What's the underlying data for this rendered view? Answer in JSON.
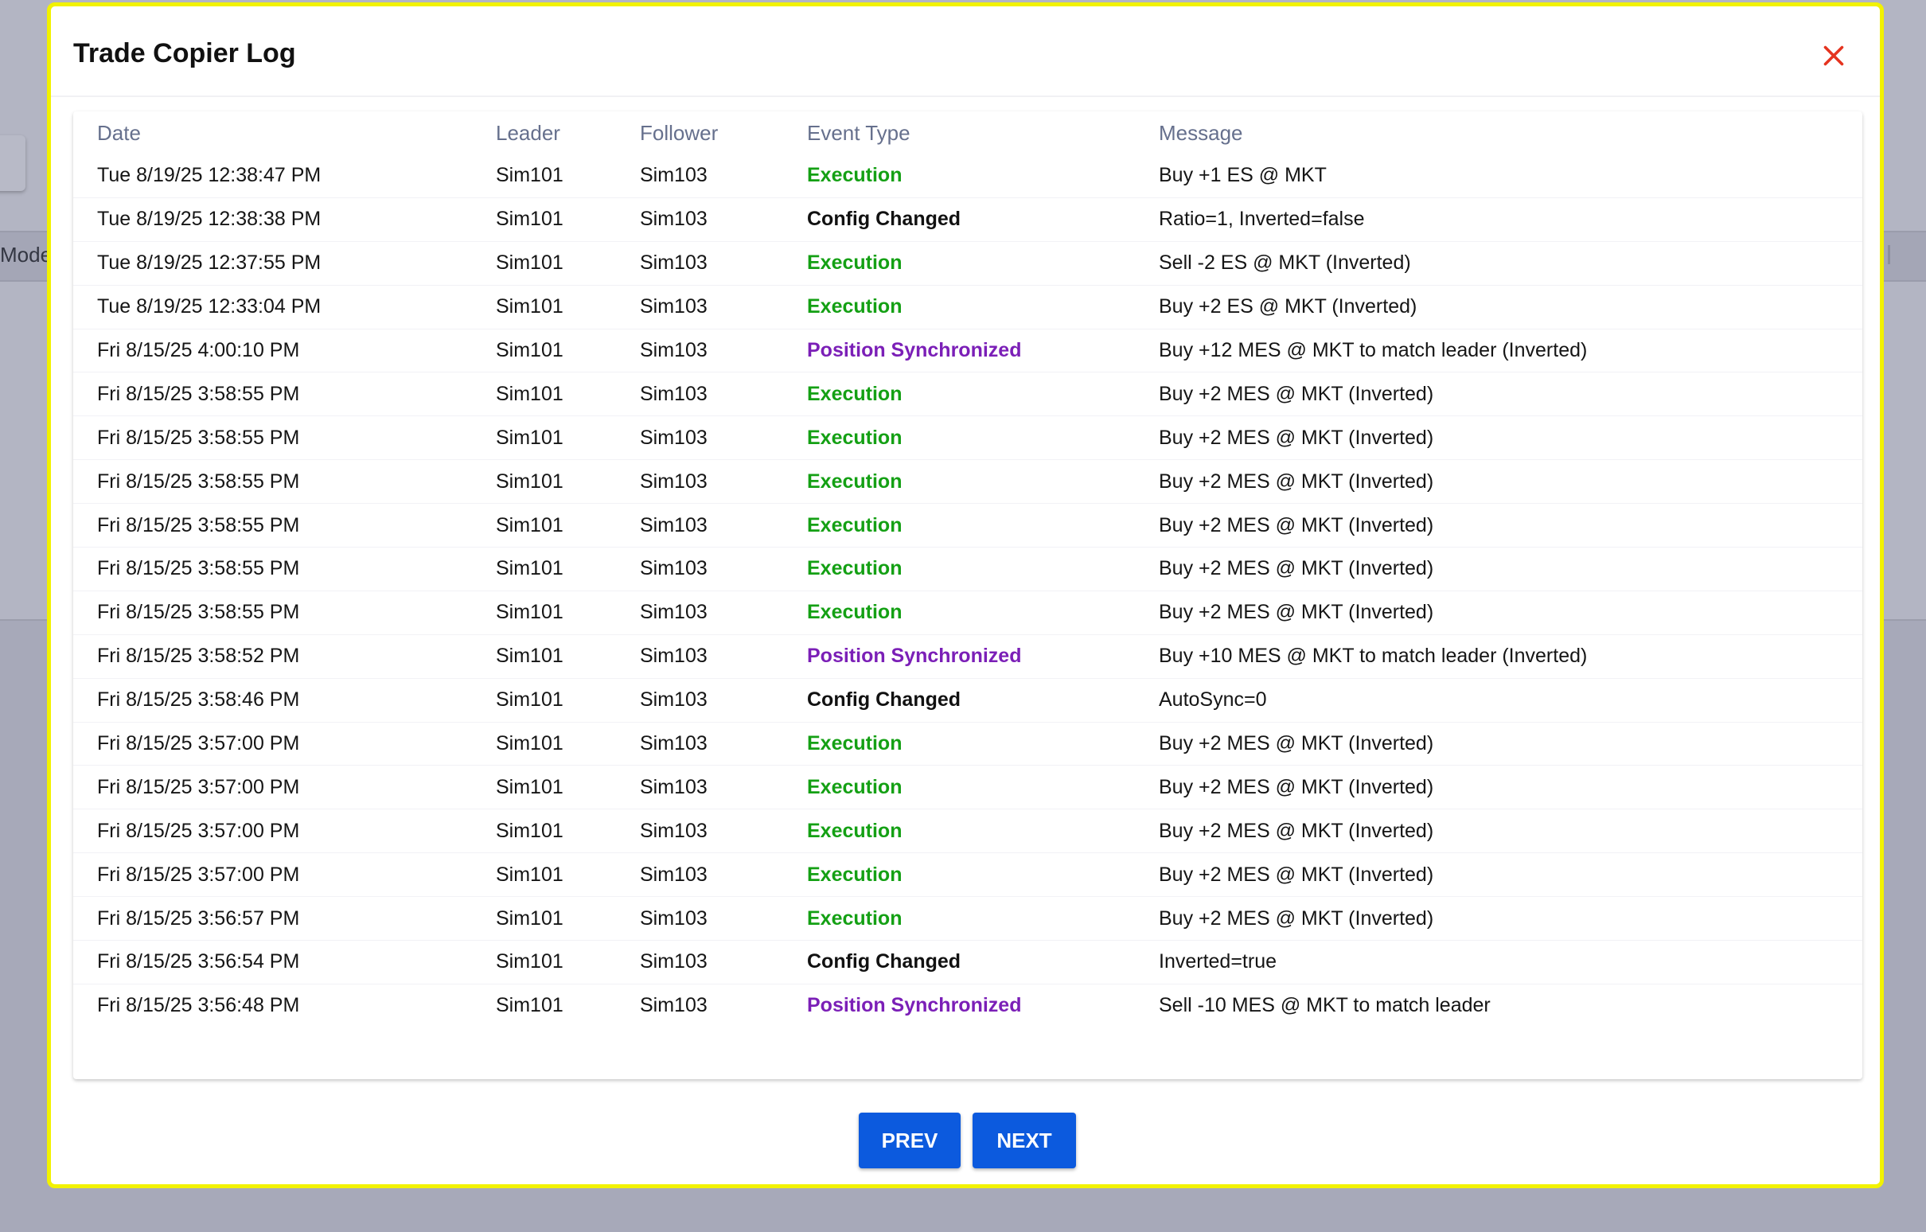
{
  "dialog": {
    "title": "Trade Copier Log",
    "close_icon": "close-icon"
  },
  "background": {
    "partial_label": "Mode"
  },
  "columns": {
    "date": "Date",
    "leader": "Leader",
    "follower": "Follower",
    "event_type": "Event Type",
    "message": "Message"
  },
  "rows": [
    {
      "date": "Tue 8/19/25 12:38:47 PM",
      "leader": "Sim101",
      "follower": "Sim103",
      "event_type": "Execution",
      "message": "Buy +1 ES @ MKT"
    },
    {
      "date": "Tue 8/19/25 12:38:38 PM",
      "leader": "Sim101",
      "follower": "Sim103",
      "event_type": "Config Changed",
      "message": "Ratio=1, Inverted=false"
    },
    {
      "date": "Tue 8/19/25 12:37:55 PM",
      "leader": "Sim101",
      "follower": "Sim103",
      "event_type": "Execution",
      "message": "Sell -2 ES @ MKT (Inverted)"
    },
    {
      "date": "Tue 8/19/25 12:33:04 PM",
      "leader": "Sim101",
      "follower": "Sim103",
      "event_type": "Execution",
      "message": "Buy +2 ES @ MKT (Inverted)"
    },
    {
      "date": "Fri 8/15/25 4:00:10 PM",
      "leader": "Sim101",
      "follower": "Sim103",
      "event_type": "Position Synchronized",
      "message": "Buy +12 MES @ MKT to match leader (Inverted)"
    },
    {
      "date": "Fri 8/15/25 3:58:55 PM",
      "leader": "Sim101",
      "follower": "Sim103",
      "event_type": "Execution",
      "message": "Buy +2 MES @ MKT (Inverted)"
    },
    {
      "date": "Fri 8/15/25 3:58:55 PM",
      "leader": "Sim101",
      "follower": "Sim103",
      "event_type": "Execution",
      "message": "Buy +2 MES @ MKT (Inverted)"
    },
    {
      "date": "Fri 8/15/25 3:58:55 PM",
      "leader": "Sim101",
      "follower": "Sim103",
      "event_type": "Execution",
      "message": "Buy +2 MES @ MKT (Inverted)"
    },
    {
      "date": "Fri 8/15/25 3:58:55 PM",
      "leader": "Sim101",
      "follower": "Sim103",
      "event_type": "Execution",
      "message": "Buy +2 MES @ MKT (Inverted)"
    },
    {
      "date": "Fri 8/15/25 3:58:55 PM",
      "leader": "Sim101",
      "follower": "Sim103",
      "event_type": "Execution",
      "message": "Buy +2 MES @ MKT (Inverted)"
    },
    {
      "date": "Fri 8/15/25 3:58:55 PM",
      "leader": "Sim101",
      "follower": "Sim103",
      "event_type": "Execution",
      "message": "Buy +2 MES @ MKT (Inverted)"
    },
    {
      "date": "Fri 8/15/25 3:58:52 PM",
      "leader": "Sim101",
      "follower": "Sim103",
      "event_type": "Position Synchronized",
      "message": "Buy +10 MES @ MKT to match leader (Inverted)"
    },
    {
      "date": "Fri 8/15/25 3:58:46 PM",
      "leader": "Sim101",
      "follower": "Sim103",
      "event_type": "Config Changed",
      "message": "AutoSync=0"
    },
    {
      "date": "Fri 8/15/25 3:57:00 PM",
      "leader": "Sim101",
      "follower": "Sim103",
      "event_type": "Execution",
      "message": "Buy +2 MES @ MKT (Inverted)"
    },
    {
      "date": "Fri 8/15/25 3:57:00 PM",
      "leader": "Sim101",
      "follower": "Sim103",
      "event_type": "Execution",
      "message": "Buy +2 MES @ MKT (Inverted)"
    },
    {
      "date": "Fri 8/15/25 3:57:00 PM",
      "leader": "Sim101",
      "follower": "Sim103",
      "event_type": "Execution",
      "message": "Buy +2 MES @ MKT (Inverted)"
    },
    {
      "date": "Fri 8/15/25 3:57:00 PM",
      "leader": "Sim101",
      "follower": "Sim103",
      "event_type": "Execution",
      "message": "Buy +2 MES @ MKT (Inverted)"
    },
    {
      "date": "Fri 8/15/25 3:56:57 PM",
      "leader": "Sim101",
      "follower": "Sim103",
      "event_type": "Execution",
      "message": "Buy +2 MES @ MKT (Inverted)"
    },
    {
      "date": "Fri 8/15/25 3:56:54 PM",
      "leader": "Sim101",
      "follower": "Sim103",
      "event_type": "Config Changed",
      "message": "Inverted=true"
    },
    {
      "date": "Fri 8/15/25 3:56:48 PM",
      "leader": "Sim101",
      "follower": "Sim103",
      "event_type": "Position Synchronized",
      "message": "Sell -10 MES @ MKT to match leader"
    }
  ],
  "event_colors": {
    "Execution": "#14a014",
    "Config Changed": "#111111",
    "Position Synchronized": "#7b1fb7"
  },
  "pagination": {
    "prev_label": "PREV",
    "next_label": "NEXT",
    "button_color": "#0c5ade"
  },
  "theme": {
    "modal_border": "#f2f200",
    "close_color": "#e5341f",
    "header_text": "#66708d"
  }
}
